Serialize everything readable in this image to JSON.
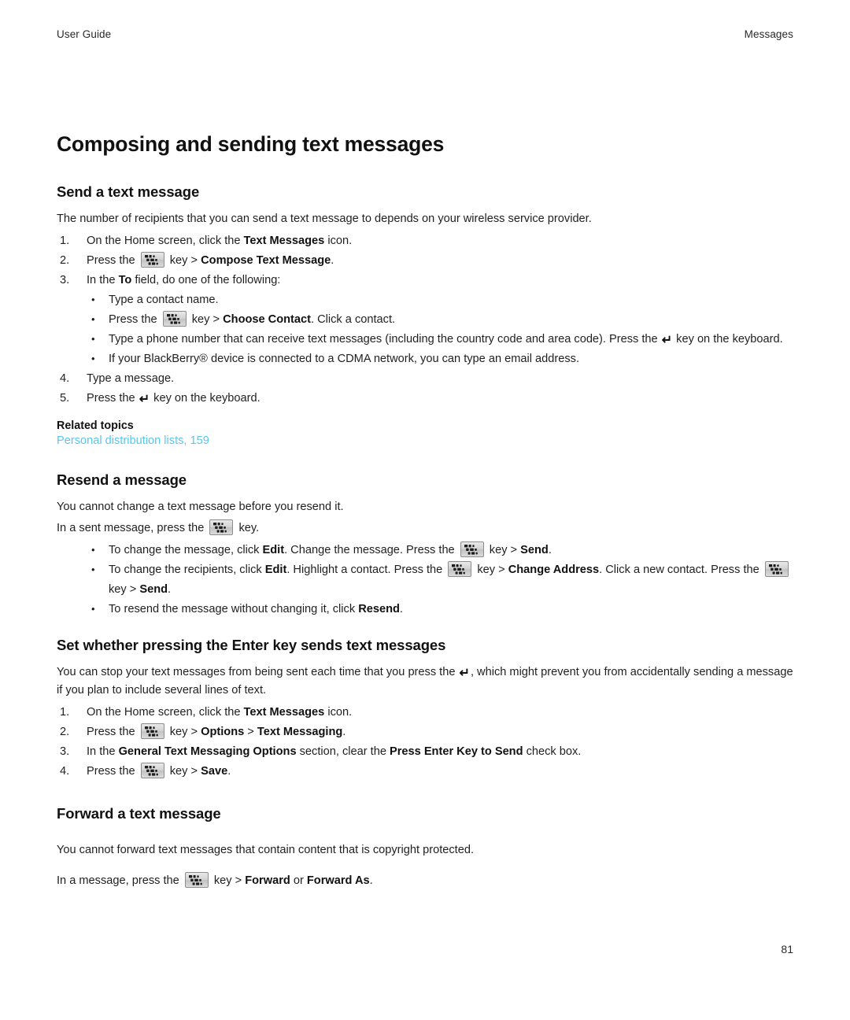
{
  "header": {
    "left": "User Guide",
    "right": "Messages"
  },
  "doc": {
    "title": "Composing and sending text messages",
    "page_number": "81"
  },
  "icons": {
    "menu_key": "blackberry-menu-key-icon",
    "enter_key": "enter-key-icon",
    "enter_glyph": "↵"
  },
  "colors": {
    "link": "#57c7f0",
    "text": "#1f1f1f",
    "heading": "#111111",
    "key_border": "#8d8d8d"
  },
  "sections": [
    {
      "heading": "Send a text message",
      "intro": "The number of recipients that you can send a text message to depends on your wireless service provider.",
      "steps": [
        {
          "num": "1.",
          "parts": [
            {
              "t": "text",
              "v": "On the Home screen, click the "
            },
            {
              "t": "bold",
              "v": "Text Messages"
            },
            {
              "t": "text",
              "v": " icon."
            }
          ]
        },
        {
          "num": "2.",
          "parts": [
            {
              "t": "text",
              "v": "Press the "
            },
            {
              "t": "menukey"
            },
            {
              "t": "text",
              "v": " key > "
            },
            {
              "t": "bold",
              "v": "Compose Text Message"
            },
            {
              "t": "text",
              "v": "."
            }
          ]
        },
        {
          "num": "3.",
          "parts": [
            {
              "t": "text",
              "v": "In the "
            },
            {
              "t": "bold",
              "v": "To"
            },
            {
              "t": "text",
              "v": " field, do one of the following:"
            }
          ]
        }
      ],
      "sub_bullets": [
        {
          "parts": [
            {
              "t": "text",
              "v": "Type a contact name."
            }
          ]
        },
        {
          "parts": [
            {
              "t": "text",
              "v": "Press the "
            },
            {
              "t": "menukey"
            },
            {
              "t": "text",
              "v": " key > "
            },
            {
              "t": "bold",
              "v": "Choose Contact"
            },
            {
              "t": "text",
              "v": ". Click a contact."
            }
          ]
        },
        {
          "parts": [
            {
              "t": "text",
              "v": "Type a phone number that can receive text messages (including the country code and area code). Press the "
            },
            {
              "t": "enterkey"
            },
            {
              "t": "text",
              "v": " key on the keyboard."
            }
          ]
        },
        {
          "parts": [
            {
              "t": "text",
              "v": "If your BlackBerry® device is connected to a CDMA network, you can type an email address."
            }
          ]
        }
      ],
      "steps_after": [
        {
          "num": "4.",
          "parts": [
            {
              "t": "text",
              "v": "Type a message."
            }
          ]
        },
        {
          "num": "5.",
          "parts": [
            {
              "t": "text",
              "v": "Press the "
            },
            {
              "t": "enterkey"
            },
            {
              "t": "text",
              "v": " key on the keyboard."
            }
          ]
        }
      ],
      "related_title": "Related topics",
      "related_link": "Personal distribution lists, 159"
    },
    {
      "heading": "Resend a message",
      "intro": "You cannot change a text message before you resend it.",
      "lead": [
        {
          "t": "text",
          "v": "In a sent message, press the "
        },
        {
          "t": "menukey"
        },
        {
          "t": "text",
          "v": " key."
        }
      ],
      "bullets": [
        {
          "parts": [
            {
              "t": "text",
              "v": "To change the message, click "
            },
            {
              "t": "bold",
              "v": "Edit"
            },
            {
              "t": "text",
              "v": ". Change the message. Press the "
            },
            {
              "t": "menukey"
            },
            {
              "t": "text",
              "v": " key > "
            },
            {
              "t": "bold",
              "v": "Send"
            },
            {
              "t": "text",
              "v": "."
            }
          ]
        },
        {
          "parts": [
            {
              "t": "text",
              "v": "To change the recipients, click "
            },
            {
              "t": "bold",
              "v": "Edit"
            },
            {
              "t": "text",
              "v": ". Highlight a contact. Press the "
            },
            {
              "t": "menukey"
            },
            {
              "t": "text",
              "v": " key > "
            },
            {
              "t": "bold",
              "v": "Change Address"
            },
            {
              "t": "text",
              "v": ". Click a new contact. Press the "
            },
            {
              "t": "menukey"
            },
            {
              "t": "text",
              "v": " key > "
            },
            {
              "t": "bold",
              "v": "Send"
            },
            {
              "t": "text",
              "v": "."
            }
          ]
        },
        {
          "parts": [
            {
              "t": "text",
              "v": "To resend the message without changing it, click "
            },
            {
              "t": "bold",
              "v": "Resend"
            },
            {
              "t": "text",
              "v": "."
            }
          ]
        }
      ]
    },
    {
      "heading": "Set whether pressing the Enter key sends text messages",
      "intro_parts": [
        {
          "t": "text",
          "v": "You can stop your text messages from being sent each time that you press the "
        },
        {
          "t": "enterkey"
        },
        {
          "t": "text",
          "v": ", which might prevent you from accidentally sending a message if you plan to include several lines of text."
        }
      ],
      "steps": [
        {
          "num": "1.",
          "parts": [
            {
              "t": "text",
              "v": "On the Home screen, click the "
            },
            {
              "t": "bold",
              "v": "Text Messages"
            },
            {
              "t": "text",
              "v": " icon."
            }
          ]
        },
        {
          "num": "2.",
          "parts": [
            {
              "t": "text",
              "v": "Press the "
            },
            {
              "t": "menukey"
            },
            {
              "t": "text",
              "v": " key > "
            },
            {
              "t": "bold",
              "v": "Options"
            },
            {
              "t": "text",
              "v": " > "
            },
            {
              "t": "bold",
              "v": "Text Messaging"
            },
            {
              "t": "text",
              "v": "."
            }
          ]
        },
        {
          "num": "3.",
          "parts": [
            {
              "t": "text",
              "v": "In the "
            },
            {
              "t": "bold",
              "v": "General Text Messaging Options"
            },
            {
              "t": "text",
              "v": " section, clear the "
            },
            {
              "t": "bold",
              "v": "Press Enter Key to Send"
            },
            {
              "t": "text",
              "v": " check box."
            }
          ]
        },
        {
          "num": "4.",
          "parts": [
            {
              "t": "text",
              "v": "Press the "
            },
            {
              "t": "menukey"
            },
            {
              "t": "text",
              "v": " key > "
            },
            {
              "t": "bold",
              "v": "Save"
            },
            {
              "t": "text",
              "v": "."
            }
          ]
        }
      ]
    },
    {
      "heading": "Forward a text message",
      "intro": "You cannot forward text messages that contain content that is copyright protected.",
      "lead": [
        {
          "t": "text",
          "v": "In a message, press the "
        },
        {
          "t": "menukey"
        },
        {
          "t": "text",
          "v": " key > "
        },
        {
          "t": "bold",
          "v": "Forward"
        },
        {
          "t": "text",
          "v": " or "
        },
        {
          "t": "bold",
          "v": "Forward As"
        },
        {
          "t": "text",
          "v": "."
        }
      ]
    }
  ]
}
